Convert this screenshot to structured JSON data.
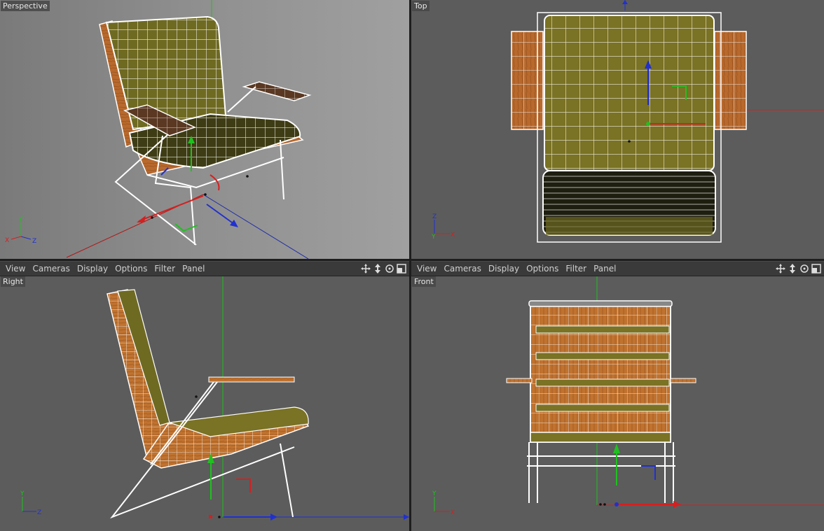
{
  "viewports": {
    "perspective": {
      "label": "Perspective"
    },
    "top": {
      "label": "Top"
    },
    "right": {
      "label": "Right"
    },
    "front": {
      "label": "Front"
    }
  },
  "menubar_left": {
    "items": [
      "View",
      "Cameras",
      "Display",
      "Options",
      "Filter",
      "Panel"
    ]
  },
  "menubar_right": {
    "items": [
      "View",
      "Cameras",
      "Display",
      "Options",
      "Filter",
      "Panel"
    ]
  },
  "axis_letters": {
    "x": "X",
    "y": "Y",
    "z": "Z"
  },
  "icons": [
    "move-view-icon",
    "scale-view-icon",
    "rotate-view-icon",
    "toggle-view-icon"
  ],
  "colors": {
    "fabric": "#6f6a22",
    "wood": "#b8692c",
    "x_axis": "#d42020",
    "y_axis": "#20c020",
    "z_axis": "#2030d0",
    "wire": "#ffffff"
  }
}
